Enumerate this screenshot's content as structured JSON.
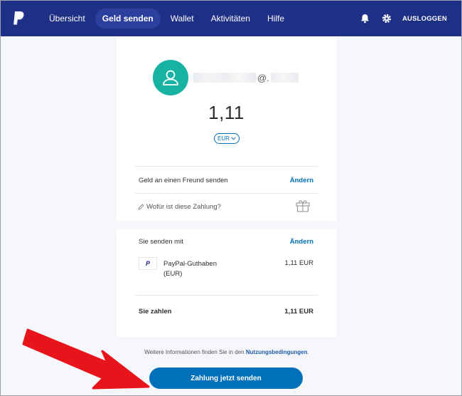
{
  "nav": {
    "items": [
      {
        "label": "Übersicht",
        "active": false
      },
      {
        "label": "Geld senden",
        "active": true
      },
      {
        "label": "Wallet",
        "active": false
      },
      {
        "label": "Aktivitäten",
        "active": false
      },
      {
        "label": "Hilfe",
        "active": false
      }
    ],
    "logout": "AUSLOGGEN",
    "icons": [
      "paypal-logo-icon",
      "bell-icon",
      "gear-icon"
    ]
  },
  "recipient": {
    "at_sign": "@."
  },
  "payment": {
    "amount": "1,11",
    "currency": "EUR",
    "type_label": "Geld an einen Freund senden",
    "type_change": "Ändern",
    "purpose_placeholder": "Wofür ist diese Zahlung?"
  },
  "funding": {
    "title": "Sie senden mit",
    "change": "Ändern",
    "source_mini": "P",
    "source_name": "PayPal-Guthaben (EUR)",
    "source_amount": "1,11 EUR",
    "total_label": "Sie zahlen",
    "total_amount": "1,11 EUR"
  },
  "footer": {
    "terms_prefix": "Weitere Informationen finden Sie in den",
    "terms_link": "Nutzungsbedingungen",
    "terms_suffix": ".",
    "send_button": "Zahlung jetzt senden"
  },
  "colors": {
    "nav_bg": "#1e2f86",
    "accent": "#0070ba",
    "avatar": "#16b3a3",
    "arrow": "#e8141b"
  }
}
